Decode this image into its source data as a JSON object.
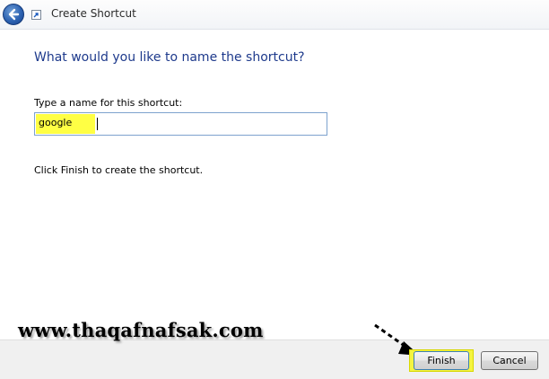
{
  "window": {
    "title": "Create Shortcut",
    "back_icon": "back-arrow-icon",
    "app_icon": "shortcut-icon"
  },
  "main": {
    "heading": "What would you like to name the shortcut?",
    "name_label": "Type a name for this shortcut:",
    "name_value": "google",
    "hint": "Click Finish to create the shortcut."
  },
  "overlay": {
    "watermark": "www.thaqafnafsak.com",
    "highlight_color": "#ffff44"
  },
  "footer": {
    "finish_label": "Finish",
    "cancel_label": "Cancel"
  },
  "colors": {
    "heading": "#1e3a8c",
    "input_border": "#7da2ce",
    "back_button": "#2d63b2"
  }
}
